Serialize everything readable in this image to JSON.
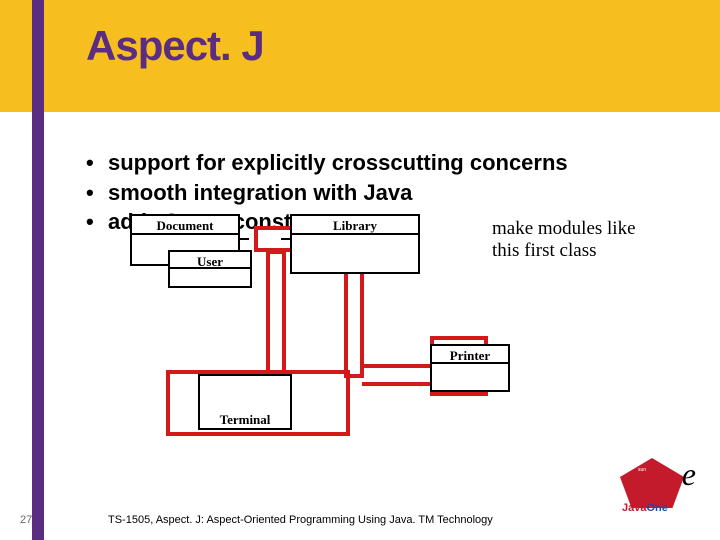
{
  "title": "Aspect. J",
  "bullets": [
    "support for explicitly crosscutting concerns",
    "smooth integration with Java",
    "adds 3 new constructs"
  ],
  "annotation": {
    "line1": "make modules like",
    "line2": "this first class"
  },
  "diagram": {
    "boxes": {
      "document": "Document",
      "library": "Library",
      "user": "User",
      "terminal": "Terminal",
      "printer": "Printer"
    }
  },
  "footer": {
    "page": "27",
    "text": "TS-1505, Aspect. J: Aspect-Oriented Programming Using Java. TM Technology"
  },
  "logo": {
    "java_j": "Java",
    "java_one": "One",
    "one_glyph": "e"
  }
}
